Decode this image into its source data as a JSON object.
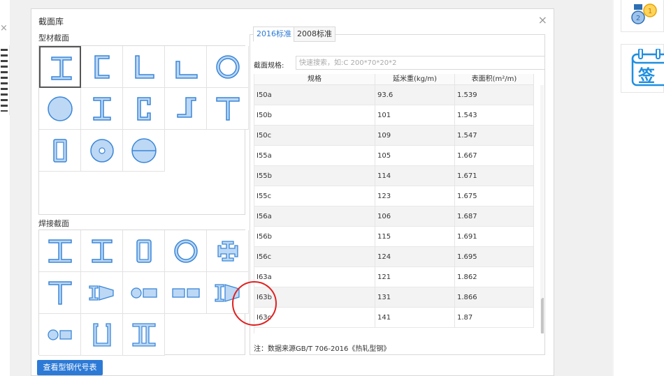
{
  "dialog": {
    "title": "截面库",
    "close": "×"
  },
  "groups": {
    "profile": "型材截面",
    "welded": "焊接截面"
  },
  "tabs": [
    "2016标准",
    "2008标准"
  ],
  "search": {
    "label": "截面规格:",
    "placeholder": "快速搜索，如:C 200*70*20*2"
  },
  "table": {
    "headers": [
      "规格",
      "延米重(kg/m)",
      "表面积(m²/m)"
    ],
    "rows": [
      [
        "I50a",
        "93.6",
        "1.539"
      ],
      [
        "I50b",
        "101",
        "1.543"
      ],
      [
        "I50c",
        "109",
        "1.547"
      ],
      [
        "I55a",
        "105",
        "1.667"
      ],
      [
        "I55b",
        "114",
        "1.671"
      ],
      [
        "I55c",
        "123",
        "1.675"
      ],
      [
        "I56a",
        "106",
        "1.687"
      ],
      [
        "I56b",
        "115",
        "1.691"
      ],
      [
        "I56c",
        "124",
        "1.695"
      ],
      [
        "I63a",
        "121",
        "1.862"
      ],
      [
        "I63b",
        "131",
        "1.866"
      ],
      [
        "I63c",
        "141",
        "1.87"
      ]
    ]
  },
  "note": "注：数据来源GB/T 706-2016《热轧型钢》",
  "view_button": "查看型钢代号表",
  "left_close": "×",
  "calendar_text": "签",
  "colors": {
    "accent": "#2d7ad6",
    "shape_fill": "#bcd8f5",
    "shape_stroke": "#3a86d8",
    "highlight": "#e02020"
  }
}
